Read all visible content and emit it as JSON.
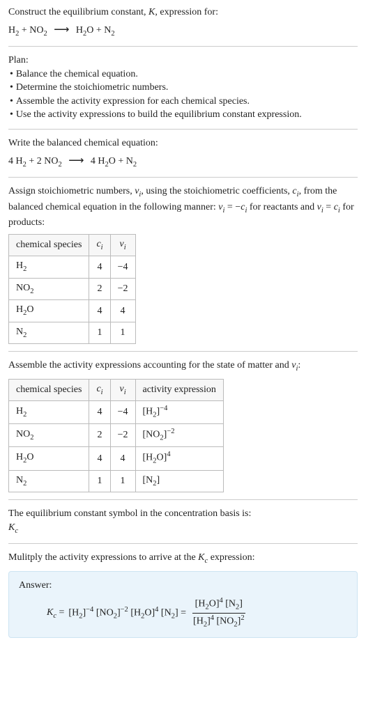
{
  "intro": {
    "line1_pre": "Construct the equilibrium constant, ",
    "K": "K",
    "line1_post": ", expression for:",
    "eq_h2": "H",
    "eq_no2": "NO",
    "eq_h2o": "H",
    "eq_n2": "N",
    "plus": " + ",
    "O": "O",
    "two": "2",
    "arrow": "⟶"
  },
  "plan": {
    "title": "Plan:",
    "items": [
      "Balance the chemical equation.",
      "Determine the stoichiometric numbers.",
      "Assemble the activity expression for each chemical species.",
      "Use the activity expressions to build the equilibrium constant expression."
    ],
    "bullet": "•"
  },
  "balanced": {
    "title": "Write the balanced chemical equation:",
    "c1": "4 ",
    "c2": "2 ",
    "c3": "4 "
  },
  "stoich": {
    "text1": "Assign stoichiometric numbers, ",
    "nu_i": "ν",
    "sub_i": "i",
    "text2": ", using the stoichiometric coefficients, ",
    "c_i": "c",
    "text3": ", from the balanced chemical equation in the following manner: ",
    "eq1a": "ν",
    "eq1b": " = −",
    "eq1c": "c",
    "text4": " for reactants and ",
    "eq2a": "ν",
    "eq2b": " = ",
    "eq2c": "c",
    "text5": " for products:"
  },
  "table1": {
    "headers": {
      "species": "chemical species",
      "c": "c",
      "nu": "ν",
      "i": "i"
    },
    "rows": [
      {
        "sp": "H",
        "sp_sub": "2",
        "c": "4",
        "nu": "−4"
      },
      {
        "sp": "NO",
        "sp_sub": "2",
        "c": "2",
        "nu": "−2"
      },
      {
        "sp": "H",
        "sp_mid": "2",
        "sp_suf": "O",
        "c": "4",
        "nu": "4"
      },
      {
        "sp": "N",
        "sp_sub": "2",
        "c": "1",
        "nu": "1"
      }
    ]
  },
  "activity": {
    "text1": "Assemble the activity expressions accounting for the state of matter and ",
    "text2": ":"
  },
  "table2": {
    "headers": {
      "species": "chemical species",
      "c": "c",
      "nu": "ν",
      "i": "i",
      "act": "activity expression"
    },
    "rows": [
      {
        "sp_base": "H",
        "sp_sub": "2",
        "c": "4",
        "nu": "−4",
        "a_pre": "[H",
        "a_sub": "2",
        "a_post": "]",
        "a_sup": "−4"
      },
      {
        "sp_base": "NO",
        "sp_sub": "2",
        "c": "2",
        "nu": "−2",
        "a_pre": "[NO",
        "a_sub": "2",
        "a_post": "]",
        "a_sup": "−2"
      },
      {
        "sp_base": "H",
        "sp_mid": "2",
        "sp_suf": "O",
        "c": "4",
        "nu": "4",
        "a_pre": "[H",
        "a_sub": "2",
        "a_mid": "O]",
        "a_sup": "4"
      },
      {
        "sp_base": "N",
        "sp_sub": "2",
        "c": "1",
        "nu": "1",
        "a_pre": "[N",
        "a_sub": "2",
        "a_post": "]",
        "a_sup": ""
      }
    ]
  },
  "basis": {
    "line1": "The equilibrium constant symbol in the concentration basis is:",
    "K": "K",
    "c": "c"
  },
  "multiply": {
    "text1": "Mulitply the activity expressions to arrive at the ",
    "K": "K",
    "c": "c",
    "text2": " expression:"
  },
  "answer": {
    "label": "Answer:",
    "K": "K",
    "c": "c",
    "eq": " = ",
    "lb": "[",
    "rb": "]",
    "H": "H",
    "N": "N",
    "O": "O",
    "NO": "NO",
    "two": "2",
    "m4": "−4",
    "m2": "−2",
    "p4": "4",
    "p2": "2"
  },
  "chart_data": {
    "type": "table",
    "title": "Stoichiometric numbers and activity expressions",
    "tables": [
      {
        "columns": [
          "chemical species",
          "c_i",
          "ν_i"
        ],
        "rows": [
          [
            "H2",
            4,
            -4
          ],
          [
            "NO2",
            2,
            -2
          ],
          [
            "H2O",
            4,
            4
          ],
          [
            "N2",
            1,
            1
          ]
        ]
      },
      {
        "columns": [
          "chemical species",
          "c_i",
          "ν_i",
          "activity expression"
        ],
        "rows": [
          [
            "H2",
            4,
            -4,
            "[H2]^-4"
          ],
          [
            "NO2",
            2,
            -2,
            "[NO2]^-2"
          ],
          [
            "H2O",
            4,
            4,
            "[H2O]^4"
          ],
          [
            "N2",
            1,
            1,
            "[N2]"
          ]
        ]
      }
    ],
    "equilibrium_constant": "K_c = [H2]^-4 [NO2]^-2 [H2O]^4 [N2] = ([H2O]^4 [N2]) / ([H2]^4 [NO2]^2)"
  }
}
